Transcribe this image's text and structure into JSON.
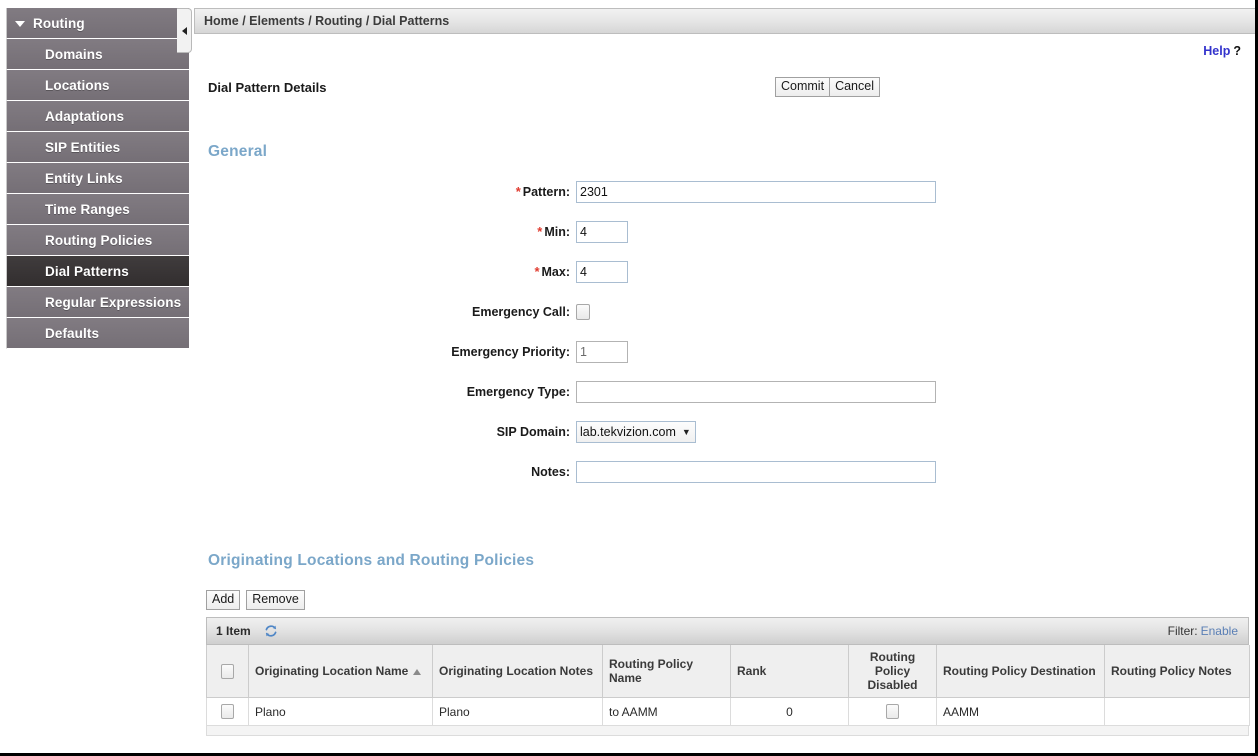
{
  "sidebar": {
    "collapse_icon": "chevron-left-icon",
    "root": {
      "label": "Routing",
      "caret_icon": "caret-down-icon"
    },
    "items": [
      {
        "label": "Domains",
        "active": false
      },
      {
        "label": "Locations",
        "active": false
      },
      {
        "label": "Adaptations",
        "active": false
      },
      {
        "label": "SIP Entities",
        "active": false
      },
      {
        "label": "Entity Links",
        "active": false
      },
      {
        "label": "Time Ranges",
        "active": false
      },
      {
        "label": "Routing Policies",
        "active": false
      },
      {
        "label": "Dial Patterns",
        "active": true
      },
      {
        "label": "Regular Expressions",
        "active": false
      },
      {
        "label": "Defaults",
        "active": false
      }
    ]
  },
  "header": {
    "breadcrumb": "Home / Elements / Routing / Dial Patterns",
    "help_label": "Help",
    "help_mark": "?"
  },
  "page": {
    "details_title": "Dial Pattern Details",
    "commit_label": "Commit",
    "cancel_label": "Cancel",
    "general_heading": "General",
    "origloc_heading": "Originating Locations and Routing Policies"
  },
  "form": {
    "required_mark": "*",
    "select_caret": "▼",
    "fields": [
      {
        "label": "Pattern:",
        "value": "2301",
        "required": true
      },
      {
        "label": "Min:",
        "value": "4",
        "required": true
      },
      {
        "label": "Max:",
        "value": "4",
        "required": true
      },
      {
        "label": "Emergency Call:",
        "value": "",
        "required": false
      },
      {
        "label": "Emergency Priority:",
        "value": "1",
        "required": false
      },
      {
        "label": "Emergency Type:",
        "value": "",
        "required": false
      },
      {
        "label": "SIP Domain:",
        "value": "lab.tekvizion.com",
        "required": false
      },
      {
        "label": "Notes:",
        "value": "",
        "required": false
      }
    ],
    "pattern_label": "Pattern:",
    "pattern_value": "2301",
    "min_label": "Min:",
    "min_value": "4",
    "max_label": "Max:",
    "max_value": "4",
    "emergency_call_label": "Emergency Call:",
    "emergency_priority_label": "Emergency Priority:",
    "emergency_priority_value": "1",
    "emergency_type_label": "Emergency Type:",
    "emergency_type_value": "",
    "sip_domain_label": "SIP Domain:",
    "sip_domain_value": "lab.tekvizion.com",
    "notes_label": "Notes:",
    "notes_value": ""
  },
  "table": {
    "add_label": "Add",
    "remove_label": "Remove",
    "item_count": "1 Item",
    "refresh_icon": "refresh-icon",
    "filter_label": "Filter:",
    "filter_action": "Enable",
    "sort_icon": "sort-ascending-icon",
    "columns": [
      {
        "label": "",
        "kind": "checkbox"
      },
      {
        "label": "Originating Location Name",
        "sorted": "asc"
      },
      {
        "label": "Originating Location Notes"
      },
      {
        "label": "Routing Policy Name"
      },
      {
        "label": "Rank"
      },
      {
        "label": "Routing Policy Disabled",
        "center": true
      },
      {
        "label": "Routing Policy Destination"
      },
      {
        "label": "Routing Policy Notes"
      }
    ],
    "rows": [
      {
        "selected": false,
        "originating_location_name": "Plano",
        "originating_location_notes": "Plano",
        "routing_policy_name": "to AAMM",
        "rank": "0",
        "routing_policy_disabled": false,
        "routing_policy_destination": "AAMM",
        "routing_policy_notes": ""
      }
    ]
  },
  "colors": {
    "sidebar_bg": "#7b757c",
    "sidebar_active": "#3a3637",
    "heading_blue": "#7ba7c9",
    "link_blue": "#3333cc",
    "required_red": "#e03b2f",
    "filter_link": "#5a7fb5"
  }
}
